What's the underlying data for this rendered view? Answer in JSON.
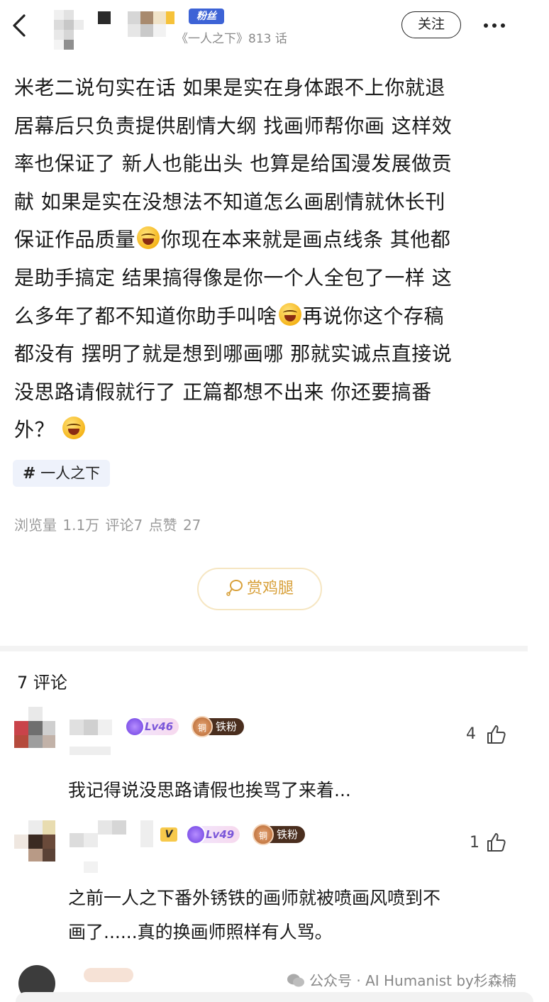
{
  "header": {
    "fan_badge": "粉丝",
    "sub_info": "《一人之下》813 话",
    "follow_label": "关注"
  },
  "post": {
    "lines": [
      "米老二说句实在话  如果是实在身体跟不上你就退",
      "居幕后只负责提供剧情大纲  找画师帮你画  这样效",
      "率也保证了  新人也能出头  也算是给国漫发展做贡",
      "献  如果是实在没想法不知道怎么画剧情就休长刊"
    ],
    "line5a": "保证作品质量",
    "line5b": "你现在本来就是画点线条  其他都",
    "line6": "是助手搞定  结果搞得像是你一个人全包了一样  这",
    "line7a": "么多年了都不知道你助手叫啥",
    "line7b": "再说你这个存稿",
    "line8": "都没有  摆明了就是想到哪画哪  那就实诚点直接说",
    "line9": "没思路请假就行了    正篇都想不出来    你还要搞番",
    "line10": "外？",
    "topic": "一人之下",
    "topic_hash": "#",
    "stats": "浏览量 1.1万  评论7  点赞 27",
    "reward_label": "赏鸡腿"
  },
  "comments_section": {
    "title": "7 评论",
    "comments": [
      {
        "level": "Lv46",
        "fan_level": "铁粉",
        "medal": "铜",
        "likes": "4",
        "text": "我记得说没思路请假也挨骂了来着..."
      },
      {
        "vip": "V",
        "level": "Lv49",
        "fan_level": "铁粉",
        "medal": "铜",
        "likes": "1",
        "text_lines": [
          "之前一人之下番外锈铁的画师就被喷画风喷到不",
          "画了......真的换画师照样有人骂。"
        ]
      }
    ]
  },
  "watermark": "公众号 · AI Humanist by杉森楠",
  "icons": {
    "back": "back-arrow-icon",
    "more": "more-dots-icon",
    "like": "thumb-up-icon",
    "reward": "drumstick-icon",
    "emoji": "laugh-cry-emoji-icon"
  },
  "colors": {
    "fan_badge_bg": "#3d63d6",
    "reward_text": "#d8a03a",
    "stats_text": "#9a9a9a",
    "level_text": "#7a56d9"
  }
}
